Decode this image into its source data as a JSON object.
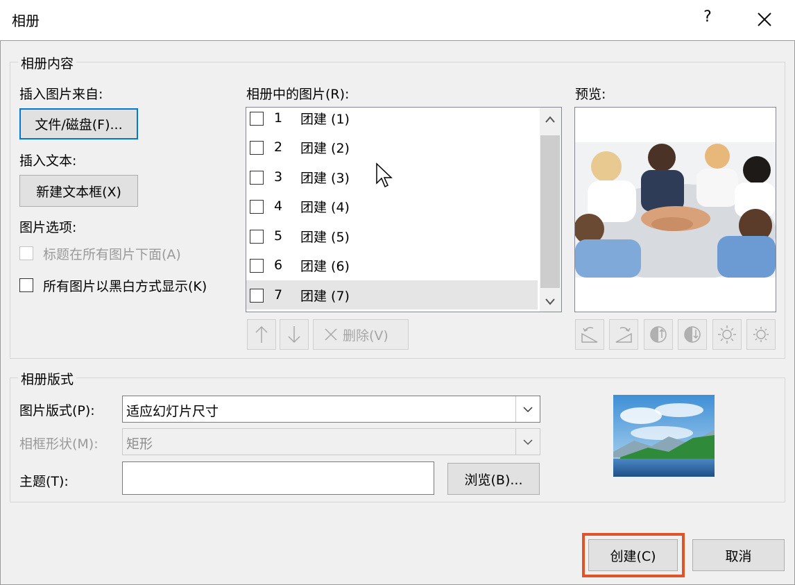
{
  "window": {
    "title": "相册",
    "help_label": "?"
  },
  "content_group": {
    "legend": "相册内容",
    "insert_from_label": "插入图片来自:",
    "file_disk_button": "文件/磁盘(F)...",
    "insert_text_label": "插入文本:",
    "new_textbox_button": "新建文本框(X)",
    "picture_options_label": "图片选项:",
    "caption_option": "标题在所有图片下面(A)",
    "bw_option": "所有图片以黑白方式显示(K)",
    "pictures_label": "相册中的图片(R):",
    "pictures": [
      {
        "num": "1",
        "name": "团建 (1)"
      },
      {
        "num": "2",
        "name": "团建 (2)"
      },
      {
        "num": "3",
        "name": "团建 (3)"
      },
      {
        "num": "4",
        "name": "团建 (4)"
      },
      {
        "num": "5",
        "name": "团建 (5)"
      },
      {
        "num": "6",
        "name": "团建 (6)"
      },
      {
        "num": "7",
        "name": "团建 (7)"
      }
    ],
    "delete_button": "删除(V)",
    "preview_label": "预览:"
  },
  "layout_group": {
    "legend": "相册版式",
    "picture_layout_label": "图片版式(P):",
    "picture_layout_value": "适应幻灯片尺寸",
    "frame_shape_label": "相框形状(M):",
    "frame_shape_value": "矩形",
    "theme_label": "主题(T):",
    "theme_value": "",
    "browse_button": "浏览(B)..."
  },
  "footer": {
    "create_button": "创建(C)",
    "cancel_button": "取消"
  },
  "colors": {
    "accent": "#0078d7",
    "highlight": "#e0542a",
    "dialog_bg": "#f0f0f0"
  }
}
